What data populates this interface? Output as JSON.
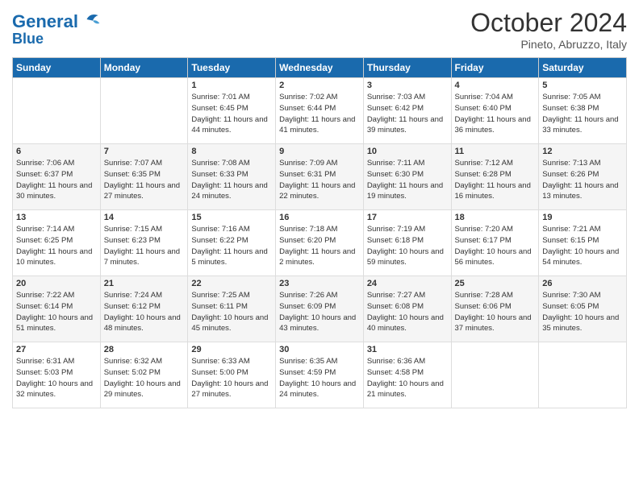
{
  "logo": {
    "line1": "General",
    "line2": "Blue"
  },
  "title": "October 2024",
  "subtitle": "Pineto, Abruzzo, Italy",
  "days_of_week": [
    "Sunday",
    "Monday",
    "Tuesday",
    "Wednesday",
    "Thursday",
    "Friday",
    "Saturday"
  ],
  "weeks": [
    [
      {
        "day": "",
        "info": ""
      },
      {
        "day": "",
        "info": ""
      },
      {
        "day": "1",
        "info": "Sunrise: 7:01 AM\nSunset: 6:45 PM\nDaylight: 11 hours and 44 minutes."
      },
      {
        "day": "2",
        "info": "Sunrise: 7:02 AM\nSunset: 6:44 PM\nDaylight: 11 hours and 41 minutes."
      },
      {
        "day": "3",
        "info": "Sunrise: 7:03 AM\nSunset: 6:42 PM\nDaylight: 11 hours and 39 minutes."
      },
      {
        "day": "4",
        "info": "Sunrise: 7:04 AM\nSunset: 6:40 PM\nDaylight: 11 hours and 36 minutes."
      },
      {
        "day": "5",
        "info": "Sunrise: 7:05 AM\nSunset: 6:38 PM\nDaylight: 11 hours and 33 minutes."
      }
    ],
    [
      {
        "day": "6",
        "info": "Sunrise: 7:06 AM\nSunset: 6:37 PM\nDaylight: 11 hours and 30 minutes."
      },
      {
        "day": "7",
        "info": "Sunrise: 7:07 AM\nSunset: 6:35 PM\nDaylight: 11 hours and 27 minutes."
      },
      {
        "day": "8",
        "info": "Sunrise: 7:08 AM\nSunset: 6:33 PM\nDaylight: 11 hours and 24 minutes."
      },
      {
        "day": "9",
        "info": "Sunrise: 7:09 AM\nSunset: 6:31 PM\nDaylight: 11 hours and 22 minutes."
      },
      {
        "day": "10",
        "info": "Sunrise: 7:11 AM\nSunset: 6:30 PM\nDaylight: 11 hours and 19 minutes."
      },
      {
        "day": "11",
        "info": "Sunrise: 7:12 AM\nSunset: 6:28 PM\nDaylight: 11 hours and 16 minutes."
      },
      {
        "day": "12",
        "info": "Sunrise: 7:13 AM\nSunset: 6:26 PM\nDaylight: 11 hours and 13 minutes."
      }
    ],
    [
      {
        "day": "13",
        "info": "Sunrise: 7:14 AM\nSunset: 6:25 PM\nDaylight: 11 hours and 10 minutes."
      },
      {
        "day": "14",
        "info": "Sunrise: 7:15 AM\nSunset: 6:23 PM\nDaylight: 11 hours and 7 minutes."
      },
      {
        "day": "15",
        "info": "Sunrise: 7:16 AM\nSunset: 6:22 PM\nDaylight: 11 hours and 5 minutes."
      },
      {
        "day": "16",
        "info": "Sunrise: 7:18 AM\nSunset: 6:20 PM\nDaylight: 11 hours and 2 minutes."
      },
      {
        "day": "17",
        "info": "Sunrise: 7:19 AM\nSunset: 6:18 PM\nDaylight: 10 hours and 59 minutes."
      },
      {
        "day": "18",
        "info": "Sunrise: 7:20 AM\nSunset: 6:17 PM\nDaylight: 10 hours and 56 minutes."
      },
      {
        "day": "19",
        "info": "Sunrise: 7:21 AM\nSunset: 6:15 PM\nDaylight: 10 hours and 54 minutes."
      }
    ],
    [
      {
        "day": "20",
        "info": "Sunrise: 7:22 AM\nSunset: 6:14 PM\nDaylight: 10 hours and 51 minutes."
      },
      {
        "day": "21",
        "info": "Sunrise: 7:24 AM\nSunset: 6:12 PM\nDaylight: 10 hours and 48 minutes."
      },
      {
        "day": "22",
        "info": "Sunrise: 7:25 AM\nSunset: 6:11 PM\nDaylight: 10 hours and 45 minutes."
      },
      {
        "day": "23",
        "info": "Sunrise: 7:26 AM\nSunset: 6:09 PM\nDaylight: 10 hours and 43 minutes."
      },
      {
        "day": "24",
        "info": "Sunrise: 7:27 AM\nSunset: 6:08 PM\nDaylight: 10 hours and 40 minutes."
      },
      {
        "day": "25",
        "info": "Sunrise: 7:28 AM\nSunset: 6:06 PM\nDaylight: 10 hours and 37 minutes."
      },
      {
        "day": "26",
        "info": "Sunrise: 7:30 AM\nSunset: 6:05 PM\nDaylight: 10 hours and 35 minutes."
      }
    ],
    [
      {
        "day": "27",
        "info": "Sunrise: 6:31 AM\nSunset: 5:03 PM\nDaylight: 10 hours and 32 minutes."
      },
      {
        "day": "28",
        "info": "Sunrise: 6:32 AM\nSunset: 5:02 PM\nDaylight: 10 hours and 29 minutes."
      },
      {
        "day": "29",
        "info": "Sunrise: 6:33 AM\nSunset: 5:00 PM\nDaylight: 10 hours and 27 minutes."
      },
      {
        "day": "30",
        "info": "Sunrise: 6:35 AM\nSunset: 4:59 PM\nDaylight: 10 hours and 24 minutes."
      },
      {
        "day": "31",
        "info": "Sunrise: 6:36 AM\nSunset: 4:58 PM\nDaylight: 10 hours and 21 minutes."
      },
      {
        "day": "",
        "info": ""
      },
      {
        "day": "",
        "info": ""
      }
    ]
  ]
}
